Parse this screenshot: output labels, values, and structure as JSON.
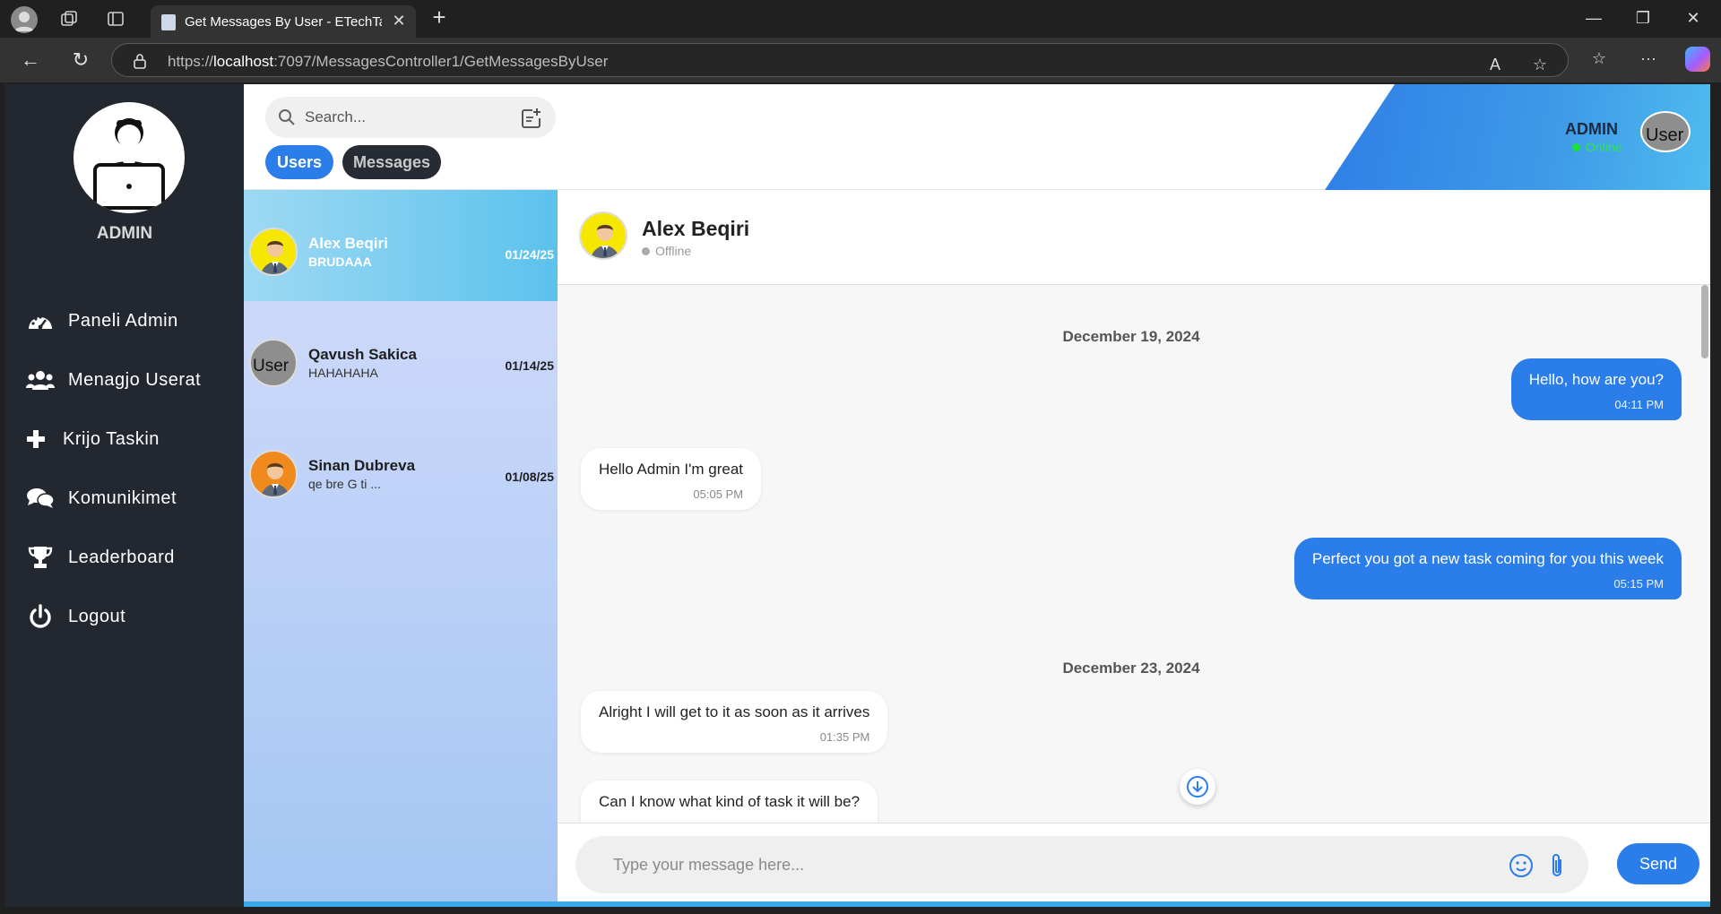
{
  "browser": {
    "tab_title": "Get Messages By User - ETechTask",
    "url_prefix": "https://",
    "url_host": "localhost",
    "url_rest": ":7097/MessagesController1/GetMessagesByUser"
  },
  "sidebar": {
    "admin_name": "ADMIN",
    "items": [
      {
        "label": "Paneli Admin",
        "icon": "dashboard-icon"
      },
      {
        "label": "Menagjo Userat",
        "icon": "users-icon"
      },
      {
        "label": "Krijo Taskin",
        "icon": "plus-icon"
      },
      {
        "label": "Komunikimet",
        "icon": "chat-icon"
      },
      {
        "label": "Leaderboard",
        "icon": "trophy-icon"
      },
      {
        "label": "Logout",
        "icon": "power-icon"
      }
    ]
  },
  "topbar": {
    "search_placeholder": "Search...",
    "tab_users": "Users",
    "tab_messages": "Messages",
    "admin_name": "ADMIN",
    "admin_status": "Online",
    "avatar_alt": "User",
    "accent": "#2b7de9"
  },
  "users": [
    {
      "name": "Alex Beqiri",
      "preview": "BRUDAAA",
      "date": "01/24/25",
      "avatar": "avatar-yellow",
      "active": true
    },
    {
      "name": "Qavush Sakica",
      "preview": "HAHAHAHA",
      "date": "01/14/25",
      "avatar": "avatar-broken",
      "alt": "User"
    },
    {
      "name": "Sinan Dubreva",
      "preview": "qe bre G ti ...",
      "date": "01/08/25",
      "avatar": "avatar-orange"
    }
  ],
  "chat": {
    "name": "Alex Beqiri",
    "status": "Offline",
    "dates": [
      "December 19, 2024",
      "December 23, 2024"
    ],
    "messages": [
      {
        "text": "Hello, how are you?",
        "time": "04:11 PM",
        "dir": "out"
      },
      {
        "text": "Hello Admin I'm great",
        "time": "05:05 PM",
        "dir": "in"
      },
      {
        "text": "Perfect you got a new task coming for you this week",
        "time": "05:15 PM",
        "dir": "out"
      },
      {
        "text": "Alright I will get to it as soon as it arrives",
        "time": "01:35 PM",
        "dir": "in"
      },
      {
        "text": "Can I know what kind of task it will be?",
        "time": "",
        "dir": "in"
      }
    ],
    "input_placeholder": "Type your message here...",
    "send_label": "Send"
  }
}
